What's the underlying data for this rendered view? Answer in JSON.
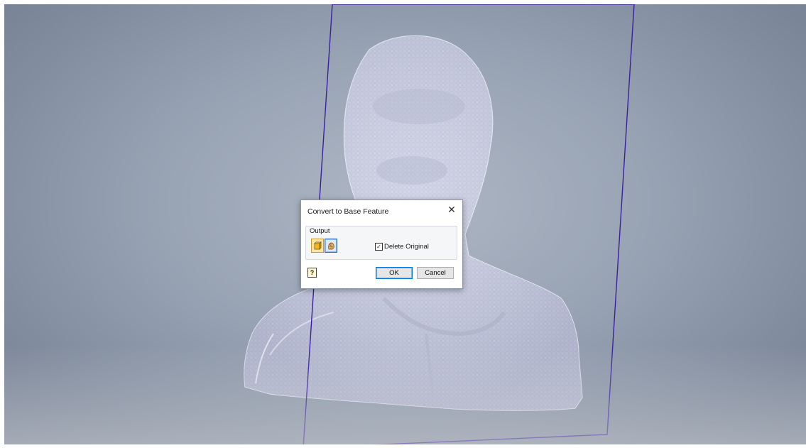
{
  "dialog": {
    "title": "Convert to Base Feature",
    "close_glyph": "✕",
    "output_group_label": "Output",
    "output_buttons": [
      {
        "name": "solid-output-icon",
        "selected": false
      },
      {
        "name": "mesh-output-icon",
        "selected": true
      }
    ],
    "delete_original": {
      "label": "Delete Original",
      "checked": true,
      "check_glyph": "✓"
    },
    "help_glyph": "?",
    "ok_label": "OK",
    "cancel_label": "Cancel"
  },
  "colors": {
    "viewport_bg": "#97a2b3",
    "mesh_fill": "#c7cbe0",
    "plane_outline": "#3a1fa0"
  }
}
